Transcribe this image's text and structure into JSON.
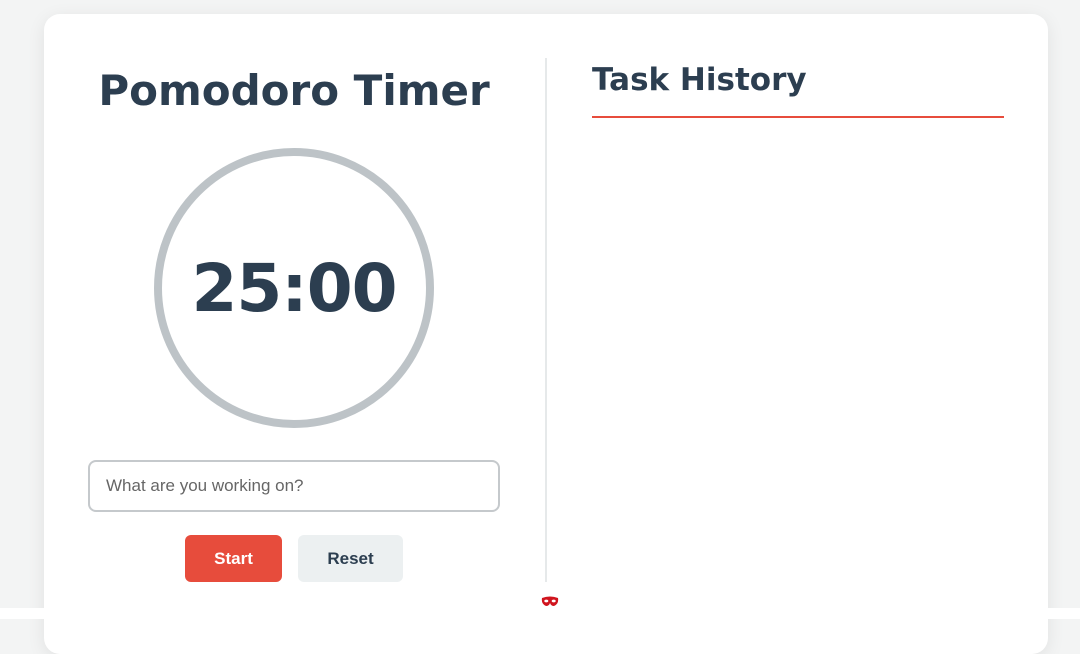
{
  "timer": {
    "title": "Pomodoro Timer",
    "display": "25:00"
  },
  "task_input": {
    "placeholder": "What are you working on?",
    "value": ""
  },
  "buttons": {
    "start_label": "Start",
    "reset_label": "Reset"
  },
  "history": {
    "title": "Task History",
    "items": []
  },
  "colors": {
    "accent": "#e74c3c",
    "text_dark": "#2c3e50",
    "ring": "#bdc3c7",
    "secondary_button": "#ecf0f1"
  },
  "icons": {
    "bottom_icon": "mask-icon"
  }
}
